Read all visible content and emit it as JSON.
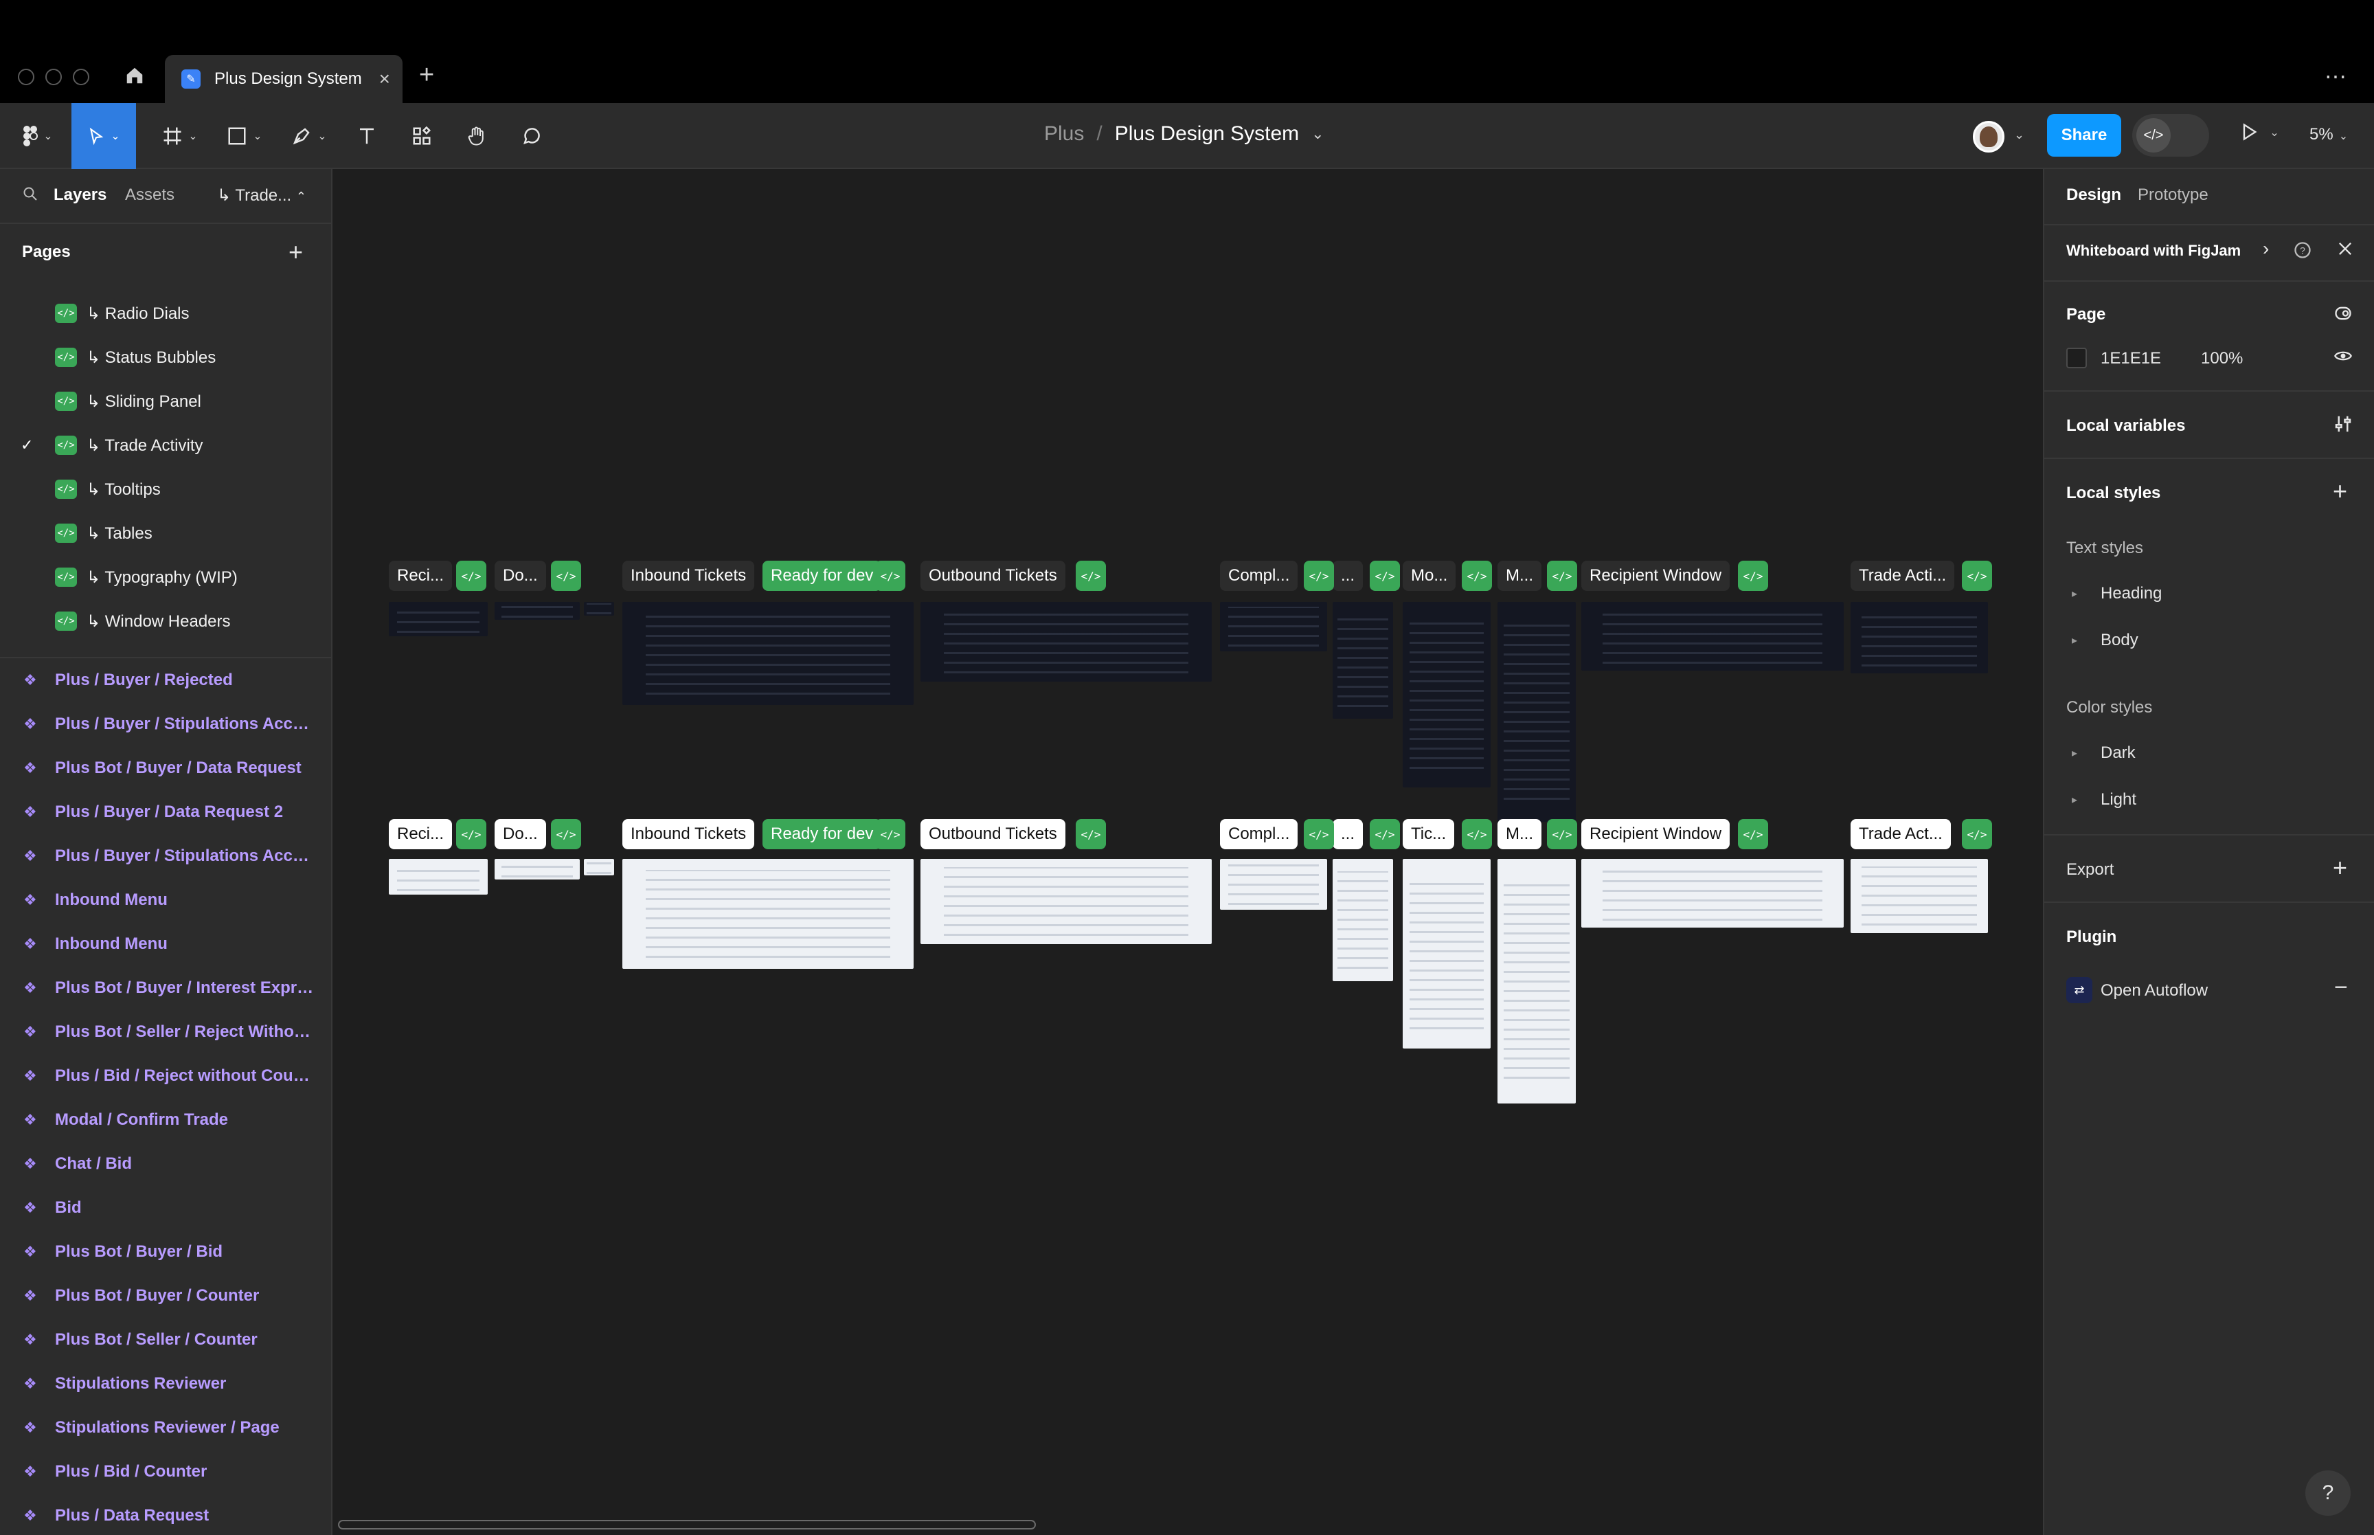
{
  "window": {
    "tab_title": "Plus Design System",
    "tab_close": "×",
    "new_tab": "+",
    "more": "⋯"
  },
  "toolbar": {
    "breadcrumb_parent": "Plus",
    "breadcrumb_sep": "/",
    "breadcrumb_current": "Plus Design System",
    "breadcrumb_caret": "⌄",
    "share_label": "Share",
    "zoom": "5%",
    "tools": [
      "figma-menu",
      "move",
      "frame",
      "shape",
      "pen",
      "text",
      "resources",
      "hand",
      "comment"
    ]
  },
  "left_panel": {
    "tabs": [
      "Layers",
      "Assets"
    ],
    "current_page_short": "↳ Trade...",
    "pages_title": "Pages",
    "pages": [
      {
        "label": "↳ Radio Dials",
        "checked": false
      },
      {
        "label": "↳ Status Bubbles",
        "checked": false
      },
      {
        "label": "↳ Sliding Panel",
        "checked": false
      },
      {
        "label": "↳ Trade Activity",
        "checked": true
      },
      {
        "label": "↳ Tooltips",
        "checked": false
      },
      {
        "label": "↳ Tables",
        "checked": false
      },
      {
        "label": "↳ Typography (WIP)",
        "checked": false
      },
      {
        "label": "↳ Window Headers",
        "checked": false
      }
    ],
    "layers": [
      "Plus / Buyer / Rejected",
      "Plus / Buyer / Stipulations Accept...",
      "Plus Bot / Buyer / Data Request",
      "Plus / Buyer / Data Request 2",
      "Plus / Buyer / Stipulations Accept...",
      "Inbound Menu",
      "Inbound Menu",
      "Plus Bot / Buyer / Interest Expres...",
      "Plus Bot / Seller / Reject Without ...",
      "Plus / Bid / Reject without Counter",
      "Modal / Confirm Trade",
      "Chat / Bid",
      "Bid",
      "Plus Bot / Buyer / Bid",
      "Plus Bot / Buyer / Counter",
      "Plus Bot / Seller / Counter",
      "Stipulations Reviewer",
      "Stipulations Reviewer / Page",
      "Plus / Bid / Counter",
      "Plus / Data Request"
    ]
  },
  "canvas": {
    "row1_labels": [
      "Reci...",
      "Do...",
      "Inbound Tickets",
      "Ready for dev",
      "Outbound Tickets",
      "Compl...",
      "...",
      "Mo...",
      "M...",
      "Recipient Window",
      "Trade Acti..."
    ],
    "row2_labels": [
      "Reci...",
      "Do...",
      "Inbound Tickets",
      "Ready for dev",
      "Outbound Tickets",
      "Compl...",
      "...",
      "Tic...",
      "M...",
      "Recipient Window",
      "Trade Act..."
    ]
  },
  "right_panel": {
    "tabs": [
      "Design",
      "Prototype"
    ],
    "whiteboard_label": "Whiteboard with FigJam",
    "page_section": "Page",
    "page_color_hex": "1E1E1E",
    "page_opacity": "100%",
    "local_variables": "Local variables",
    "local_styles": "Local styles",
    "text_styles": "Text styles",
    "text_style_items": [
      "Heading",
      "Body"
    ],
    "color_styles": "Color styles",
    "color_style_items": [
      "Dark",
      "Light"
    ],
    "export": "Export",
    "plugin": "Plugin",
    "plugin_item": "Open Autoflow"
  },
  "colors": {
    "accent": "#0d99ff",
    "active_tool": "#2f7de1",
    "dev_green": "#3aa757",
    "component_purple": "#b89cff",
    "canvas_bg": "#1e1e1e",
    "panel_bg": "#2c2c2c"
  }
}
